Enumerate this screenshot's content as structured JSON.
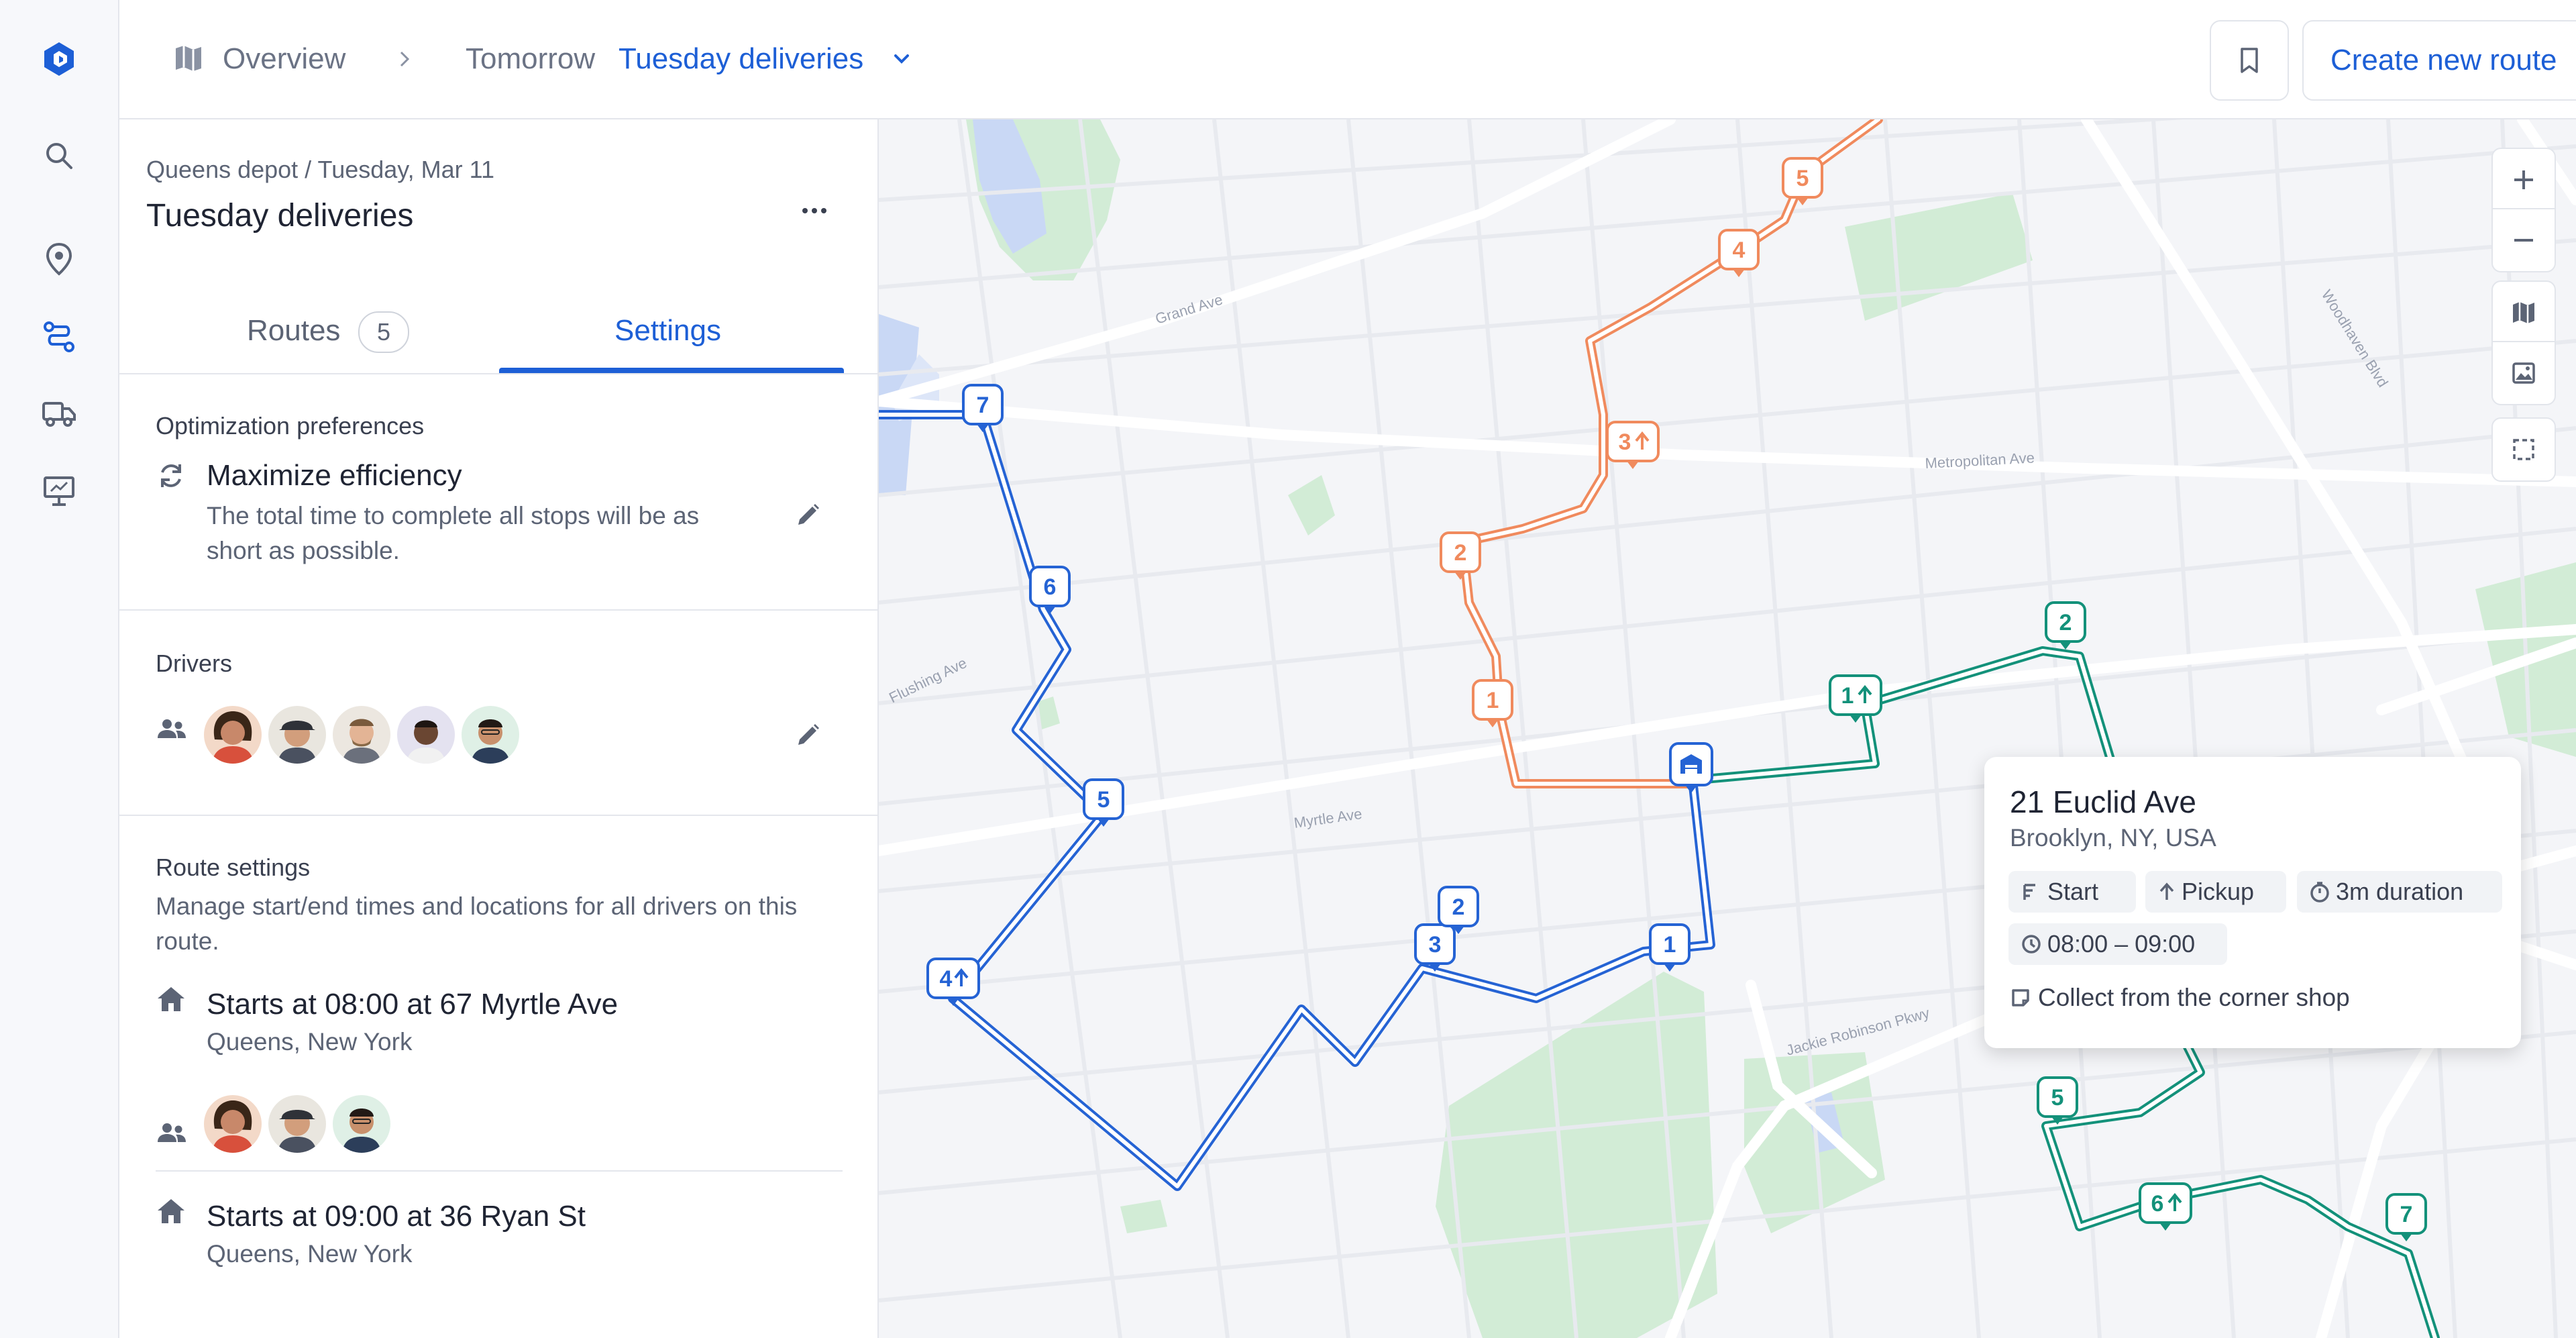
{
  "colors": {
    "accent": "#1d5fd6",
    "route_blue": "#2563d4",
    "route_orange": "#f08a5d",
    "route_teal": "#13917a",
    "park": "#d2ecd6",
    "water": "#c9d8f5"
  },
  "rail": {
    "icons": [
      "logo-icon",
      "search-icon",
      "location-pin-icon",
      "routes-icon",
      "truck-icon",
      "presentation-icon"
    ]
  },
  "header": {
    "breadcrumb_overview": "Overview",
    "breadcrumb_day": "Tomorrow",
    "breadcrumb_current": "Tuesday deliveries",
    "create_button": "Create new route"
  },
  "panel": {
    "subtitle": "Queens depot / Tuesday, Mar 11",
    "title": "Tuesday deliveries",
    "tabs": [
      {
        "label": "Routes",
        "count": "5"
      },
      {
        "label": "Settings"
      }
    ],
    "active_tab": "Settings",
    "optimization": {
      "heading": "Optimization preferences",
      "name": "Maximize efficiency",
      "description_line1": "The total time to complete all stops will be as",
      "description_line2": "short as possible."
    },
    "drivers": {
      "heading": "Drivers",
      "count": 5
    },
    "route_settings": {
      "heading": "Route settings",
      "description_line1": "Manage start/end times and locations for all drivers on this",
      "description_line2": "route.",
      "entries": [
        {
          "title": "Starts at 08:00 at 67 Myrtle Ave",
          "location": "Queens, New York",
          "driver_count": 3
        },
        {
          "title": "Starts at 09:00 at 36 Ryan St",
          "location": "Queens, New York"
        }
      ]
    }
  },
  "map": {
    "street_labels": [
      "Grand Ave",
      "Metropolitan Ave",
      "Woodhaven Blvd",
      "Flushing Ave",
      "Myrtle Ave",
      "Jackie Robinson Pkwy"
    ],
    "routes": {
      "blue": {
        "stops": [
          "7",
          "6",
          "5",
          "4",
          "3",
          "2",
          "1"
        ]
      },
      "orange": {
        "stops": [
          "5",
          "4",
          "3",
          "2",
          "1"
        ]
      },
      "teal": {
        "stops": [
          "2",
          "1",
          "5",
          "6",
          "7"
        ]
      }
    },
    "popup": {
      "title": "21 Euclid Ave",
      "subtitle": "Brooklyn, NY, USA",
      "chip_start": "Start",
      "chip_pickup": "Pickup",
      "chip_duration": "3m duration",
      "chip_time": "08:00 – 09:00",
      "note": "Collect from the corner shop"
    }
  }
}
